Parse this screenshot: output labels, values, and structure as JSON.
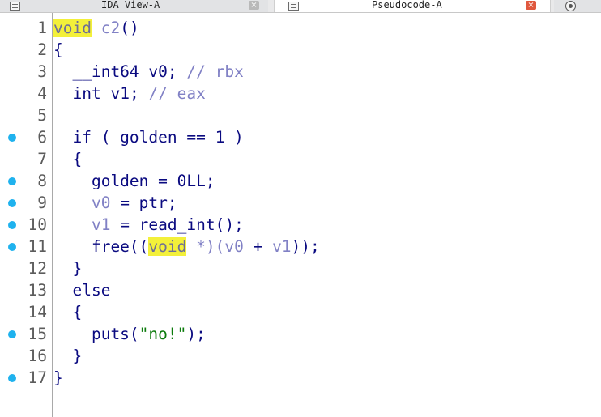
{
  "tabs": [
    {
      "title": "IDA View-A",
      "close_glyph": "×"
    },
    {
      "title": "Pseudocode-A",
      "close_glyph": "×"
    }
  ],
  "colors": {
    "keyword": "#0a0a80",
    "local_variable": "#8181c5",
    "comment": "#8181c5",
    "string": "#0c7b0c",
    "highlight": "#f3f03a",
    "breakpoint_dot": "#1fb2ee"
  },
  "code": {
    "lines": [
      {
        "n": "1",
        "bp": false,
        "tokens": [
          {
            "t": "void",
            "c": "hl"
          },
          {
            "t": " ",
            "c": "plain"
          },
          {
            "t": "c2",
            "c": "var"
          },
          {
            "t": "()",
            "c": "plain"
          }
        ]
      },
      {
        "n": "2",
        "bp": false,
        "tokens": [
          {
            "t": "{",
            "c": "plain"
          }
        ]
      },
      {
        "n": "3",
        "bp": false,
        "tokens": [
          {
            "t": "  __int64 ",
            "c": "plain"
          },
          {
            "t": "v0",
            "c": "plain"
          },
          {
            "t": "; ",
            "c": "plain"
          },
          {
            "t": "// rbx",
            "c": "cmt"
          }
        ]
      },
      {
        "n": "4",
        "bp": false,
        "tokens": [
          {
            "t": "  int ",
            "c": "plain"
          },
          {
            "t": "v1",
            "c": "plain"
          },
          {
            "t": "; ",
            "c": "plain"
          },
          {
            "t": "// eax",
            "c": "cmt"
          }
        ]
      },
      {
        "n": "5",
        "bp": false,
        "tokens": []
      },
      {
        "n": "6",
        "bp": true,
        "tokens": [
          {
            "t": "  if ( golden == 1 )",
            "c": "plain"
          }
        ]
      },
      {
        "n": "7",
        "bp": false,
        "tokens": [
          {
            "t": "  {",
            "c": "plain"
          }
        ]
      },
      {
        "n": "8",
        "bp": true,
        "tokens": [
          {
            "t": "    golden = 0LL;",
            "c": "plain"
          }
        ]
      },
      {
        "n": "9",
        "bp": true,
        "tokens": [
          {
            "t": "    ",
            "c": "plain"
          },
          {
            "t": "v0",
            "c": "var"
          },
          {
            "t": " = ptr;",
            "c": "plain"
          }
        ]
      },
      {
        "n": "10",
        "bp": true,
        "tokens": [
          {
            "t": "    ",
            "c": "plain"
          },
          {
            "t": "v1",
            "c": "var"
          },
          {
            "t": " = read_int();",
            "c": "plain"
          }
        ]
      },
      {
        "n": "11",
        "bp": true,
        "tokens": [
          {
            "t": "    free((",
            "c": "plain"
          },
          {
            "t": "void",
            "c": "hl"
          },
          {
            "t": " *)(",
            "c": "var"
          },
          {
            "t": "v0",
            "c": "var"
          },
          {
            "t": " + ",
            "c": "plain"
          },
          {
            "t": "v1",
            "c": "var"
          },
          {
            "t": "));",
            "c": "plain"
          }
        ]
      },
      {
        "n": "12",
        "bp": false,
        "tokens": [
          {
            "t": "  }",
            "c": "plain"
          }
        ]
      },
      {
        "n": "13",
        "bp": false,
        "tokens": [
          {
            "t": "  else",
            "c": "plain"
          }
        ]
      },
      {
        "n": "14",
        "bp": false,
        "tokens": [
          {
            "t": "  {",
            "c": "plain"
          }
        ]
      },
      {
        "n": "15",
        "bp": true,
        "tokens": [
          {
            "t": "    puts(",
            "c": "plain"
          },
          {
            "t": "\"no!\"",
            "c": "str"
          },
          {
            "t": ");",
            "c": "plain"
          }
        ]
      },
      {
        "n": "16",
        "bp": false,
        "tokens": [
          {
            "t": "  }",
            "c": "plain"
          }
        ]
      },
      {
        "n": "17",
        "bp": true,
        "tokens": [
          {
            "t": "}",
            "c": "plain"
          }
        ]
      }
    ]
  }
}
